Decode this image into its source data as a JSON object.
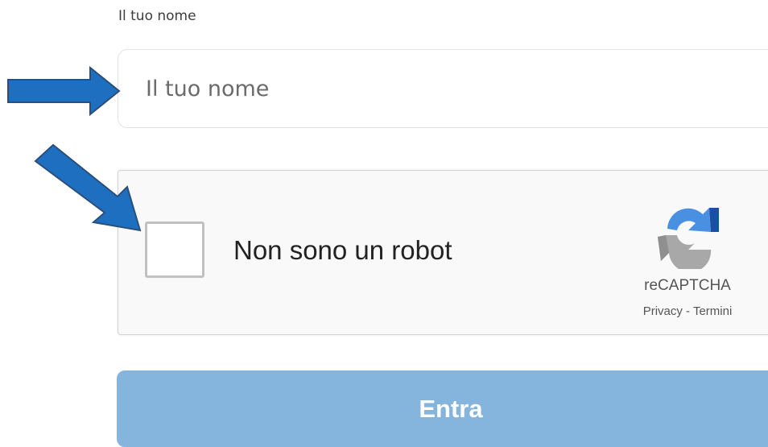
{
  "form": {
    "name_label": "Il tuo nome",
    "name_placeholder": "Il tuo nome",
    "name_value": ""
  },
  "recaptcha": {
    "checkbox_label": "Non sono un robot",
    "brand": "reCAPTCHA",
    "privacy_link": "Privacy",
    "separator": " - ",
    "terms_link": "Termini",
    "checked": false
  },
  "submit": {
    "label": "Entra"
  },
  "annotations": {
    "arrow_color": "#1f6fc0",
    "arrow_icon": "arrow-annotation-icon"
  },
  "colors": {
    "button_bg": "#85b4dc",
    "captcha_bg": "#f9f9f9"
  }
}
